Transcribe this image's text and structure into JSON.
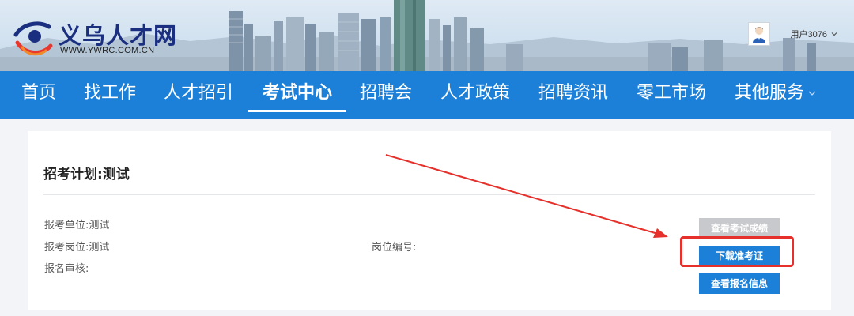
{
  "header": {
    "logo_title": "义乌人才网",
    "logo_url_text": "WWW.YWRC.COM.CN",
    "user_name": "用户3076"
  },
  "nav": {
    "items": [
      "首页",
      "找工作",
      "人才招引",
      "考试中心",
      "招聘会",
      "人才政策",
      "招聘资讯",
      "零工市场",
      "其他服务"
    ],
    "active_index": 3
  },
  "exam": {
    "title": "招考计划:测试",
    "unit_label": "报考单位:测试",
    "position_label": "报考岗位:测试",
    "position_code_label": "岗位编号:",
    "review_label": "报名审核:",
    "btn_view_score": "查看考试成绩",
    "btn_download_admission": "下载准考证",
    "btn_view_registration": "查看报名信息"
  },
  "colors": {
    "nav_bg": "#1c80d8",
    "brand_navy": "#1b2f80",
    "button_blue": "#1c80d8",
    "button_disabled": "#c8c9cc",
    "annotation_red": "#e5302b"
  }
}
